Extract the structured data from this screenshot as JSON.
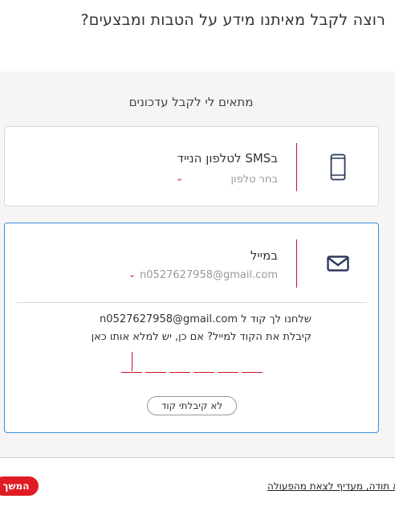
{
  "header": {
    "title": "רוצה לקבל מאיתנו מידע על הטבות ומבצעים?"
  },
  "section": {
    "title": "מתאים לי לקבל עדכונים"
  },
  "sms_card": {
    "label": "בSMS לטלפון הנייד",
    "sub": "בחר טלפון",
    "icon": "mobile-phone-icon",
    "chevron": "⌄"
  },
  "mail_card": {
    "label": "במייל",
    "sub": "n0527627958@gmail.com",
    "icon": "envelope-icon",
    "chevron": "⌄",
    "sent_text": "שלחנו לך קוד ל n0527627958@gmail.com",
    "hint_text": "קיבלת את הקוד למייל? אם כן, יש למלא אותו כאן",
    "code_length": 6,
    "no_code_label": "לא קיבלתי קוד"
  },
  "footer": {
    "continue_label": "המשך",
    "skip_label": "לא תודה, מעדיף לצאת מהפעולה"
  },
  "colors": {
    "accent": "#e01b24",
    "focus_border": "#3a8fd9",
    "icon": "#2d3a5a"
  }
}
